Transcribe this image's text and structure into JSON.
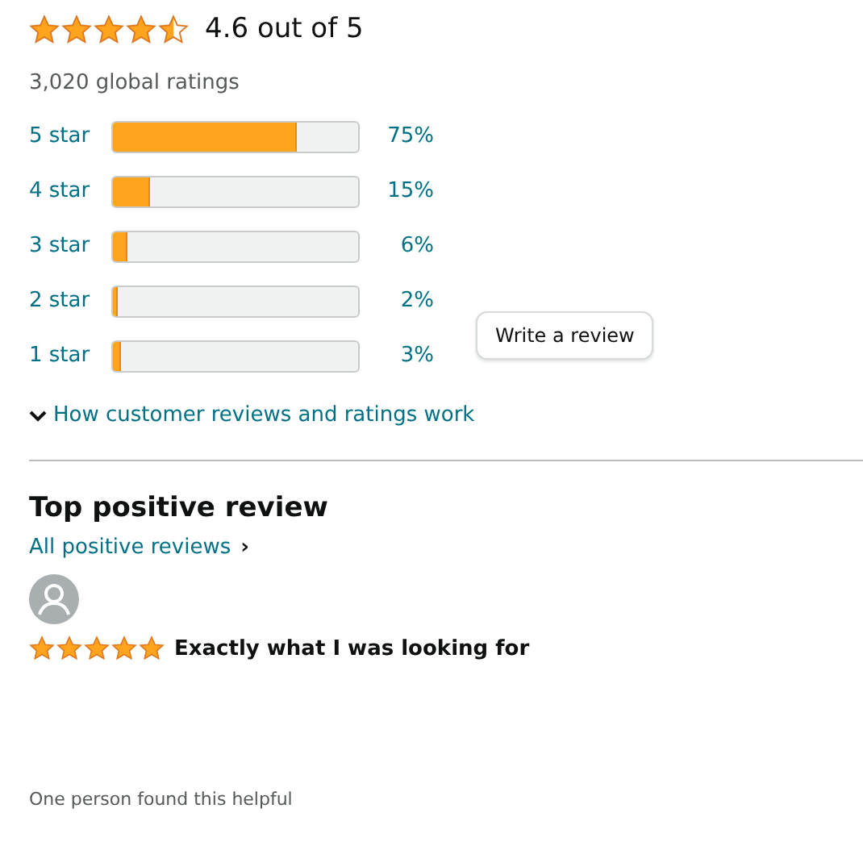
{
  "summary": {
    "stars": 4.5,
    "rating": "4.6 out of 5",
    "total": "3,020 global ratings"
  },
  "histogram": [
    {
      "label": "5 star",
      "level": 0.75,
      "percent": "75%"
    },
    {
      "label": "4 star",
      "level": 0.15,
      "percent": "15%"
    },
    {
      "label": "3 star",
      "level": 0.06,
      "percent": "6%"
    },
    {
      "label": "2 star",
      "level": 0.02,
      "percent": "2%"
    },
    {
      "label": "1 star",
      "level": 0.03,
      "percent": "3%"
    }
  ],
  "write_review_button": "Write a review",
  "how_link": "How customer reviews and ratings work",
  "top_review": {
    "heading": "Top positive review",
    "all_link": "All positive reviews",
    "all_link_arrow": "›",
    "stars": 5,
    "title": "Exactly what I was looking for",
    "helpful": "One person found this helpful"
  }
}
